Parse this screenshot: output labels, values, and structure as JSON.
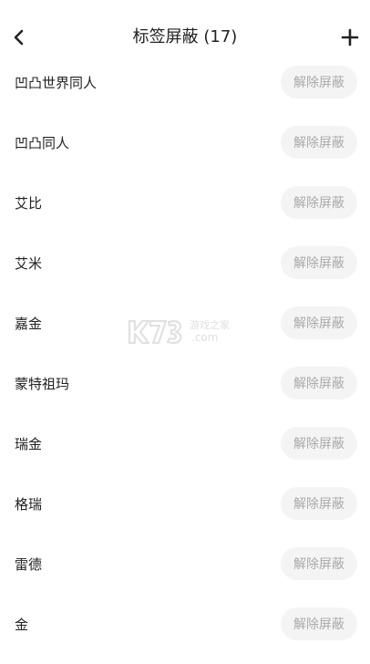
{
  "header": {
    "title": "标签屏蔽 (17)",
    "back_icon": "chevron-left-icon",
    "add_icon": "plus-icon"
  },
  "list": {
    "button_label": "解除屏蔽",
    "items": [
      {
        "name": "凹凸世界同人"
      },
      {
        "name": "凹凸同人"
      },
      {
        "name": "艾比"
      },
      {
        "name": "艾米"
      },
      {
        "name": "嘉金"
      },
      {
        "name": "蒙特祖玛"
      },
      {
        "name": "瑞金"
      },
      {
        "name": "格瑞"
      },
      {
        "name": "雷德"
      },
      {
        "name": "金"
      }
    ]
  },
  "watermark": {
    "site": "游戏之家",
    "domain": ".com"
  },
  "colors": {
    "text": "#222222",
    "button_bg": "#f4f4f4",
    "button_text": "#a9a9a9"
  }
}
